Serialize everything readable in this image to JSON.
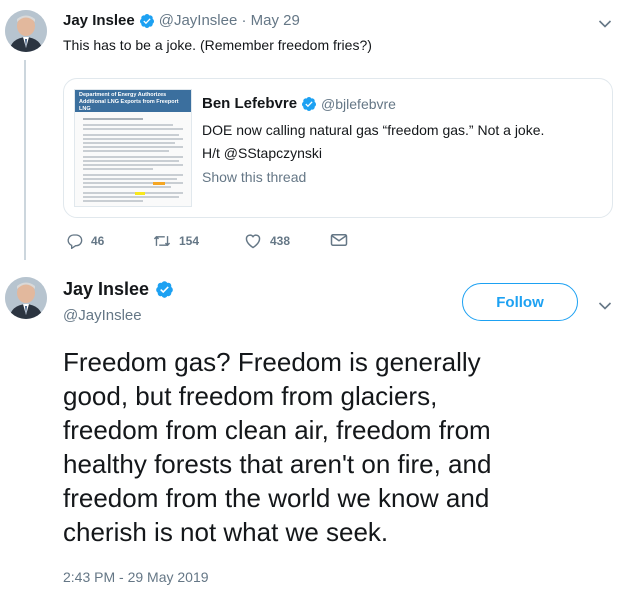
{
  "top_tweet": {
    "author_name": "Jay Inslee",
    "handle_date": "@JayInslee · May 29",
    "text": "This has to be a joke. (Remember freedom fries?)",
    "actions": {
      "replies": "46",
      "retweets": "154",
      "likes": "438"
    }
  },
  "quoted_tweet": {
    "author_name": "Ben Lefebvre",
    "handle": "@bjlefebvre",
    "text_line1": "DOE now calling natural gas “freedom gas.” Not a joke.",
    "text_line2": "H/t @SStapczynski",
    "show_thread": "Show this thread",
    "doc_header": "Department of Energy Authorizes Additional LNG Exports from Freeport LNG"
  },
  "main_tweet": {
    "author_name": "Jay Inslee",
    "handle": "@JayInslee",
    "follow_label": "Follow",
    "lines": [
      "Freedom gas? Freedom is generally",
      "good, but freedom from glaciers,",
      "freedom from clean air, freedom from",
      "healthy forests that aren't on fire, and",
      "freedom from the world we know and",
      "cherish is not what we seek."
    ],
    "timestamp": "2:43 PM - 29 May 2019"
  },
  "colors": {
    "accent": "#1da1f2",
    "muted": "#657786",
    "text": "#14171a",
    "border": "#e1e8ed"
  },
  "icons": [
    "chevron-down-icon",
    "verified-badge-icon",
    "reply-icon",
    "retweet-icon",
    "like-icon",
    "direct-message-icon"
  ]
}
